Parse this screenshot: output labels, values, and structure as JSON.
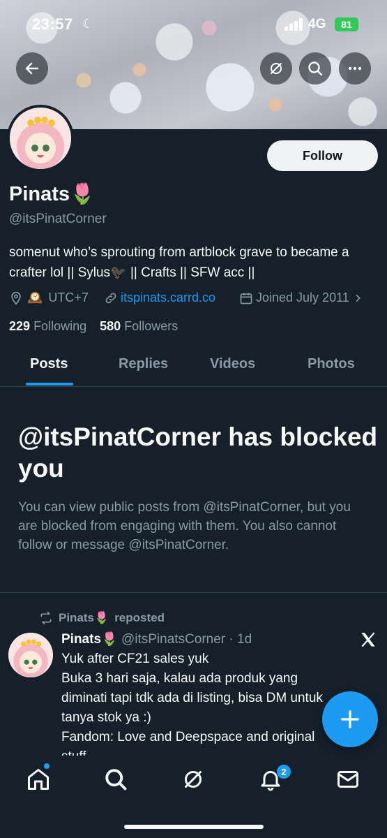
{
  "status_bar": {
    "time": "23:57",
    "network": "4G",
    "battery": "81"
  },
  "profile": {
    "name": "Pinats",
    "name_emoji": "🌷",
    "handle": "@itsPinatCorner",
    "bio": "somenut who’s sprouting from artblock grave to became a crafter lol || Sylus🐦‍⬛ || Crafts || SFW acc ||",
    "location": "UTC+7",
    "location_emoji": "🕰️",
    "website": "itspinats.carrd.co",
    "joined": "Joined July 2011",
    "following_count": "229",
    "following_label": "Following",
    "followers_count": "580",
    "followers_label": "Followers",
    "follow_button": "Follow"
  },
  "tabs": [
    {
      "label": "Posts",
      "active": true
    },
    {
      "label": "Replies",
      "active": false
    },
    {
      "label": "Videos",
      "active": false
    },
    {
      "label": "Photos",
      "active": false
    }
  ],
  "blocked": {
    "title": "@itsPinatCorner has blocked you",
    "description": "You can view public posts from @itsPinatCorner, but you are blocked from engaging with them. You also cannot follow or message @itsPinatCorner."
  },
  "post": {
    "repost_name": "Pinats🌷",
    "repost_label": "reposted",
    "author_name": "Pinats🌷",
    "author_handle": "@itsPinatsCorner",
    "time": "· 1d",
    "body": "Yuk after CF21 sales yuk\nBuka 3 hari saja, kalau ada produk yang diminati tapi tdk ada di listing, bisa DM untuk tanya stok ya :)\nFandom: Love and Deepspace and original stuff"
  },
  "nav": {
    "notifications_badge": "2"
  },
  "colors": {
    "accent": "#1d9bf0",
    "background": "#15202b",
    "muted": "#8b98a5",
    "battery": "#34c759"
  }
}
